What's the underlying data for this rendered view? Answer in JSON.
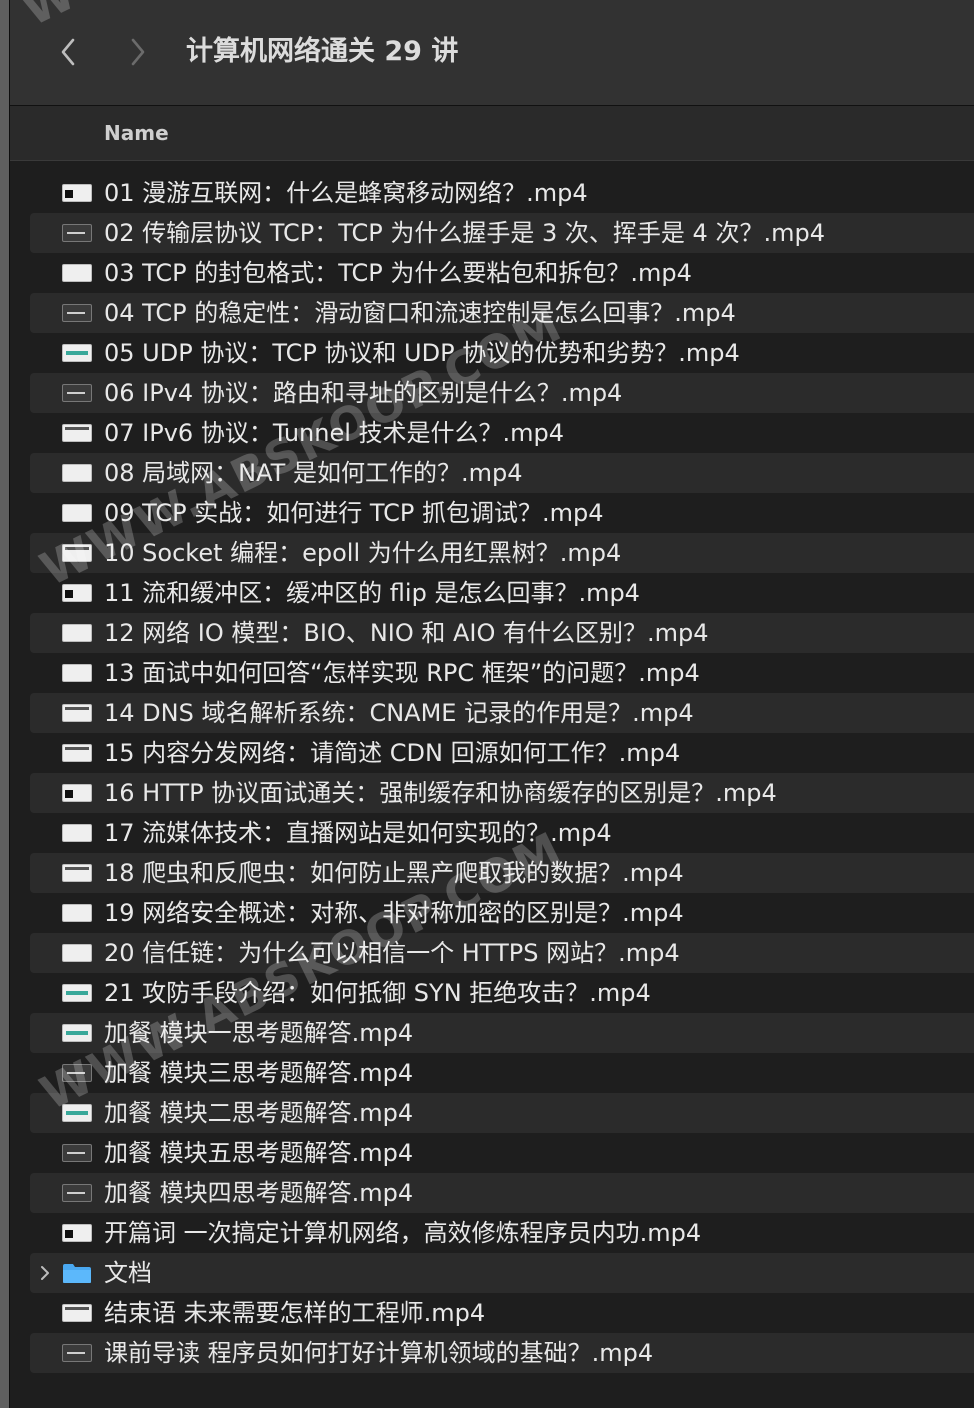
{
  "window": {
    "title": "计算机网络通关 29 讲",
    "back_icon": "chevron-left-icon",
    "forward_icon": "chevron-right-icon"
  },
  "columns": {
    "name": "Name"
  },
  "watermark": "WWW.ABSKOOP.COM",
  "files": [
    {
      "name": "01  漫游互联网：什么是蜂窝移动网络？.mp4",
      "kind": "video",
      "thumb": "mark"
    },
    {
      "name": "02  传输层协议 TCP：TCP 为什么握手是 3 次、挥手是 4 次？.mp4",
      "kind": "video",
      "thumb": "dark"
    },
    {
      "name": "03  TCP 的封包格式：TCP 为什么要粘包和拆包？.mp4",
      "kind": "video",
      "thumb": "plain"
    },
    {
      "name": "04  TCP 的稳定性：滑动窗口和流速控制是怎么回事？.mp4",
      "kind": "video",
      "thumb": "dark"
    },
    {
      "name": "05  UDP 协议：TCP 协议和 UDP 协议的优势和劣势？.mp4",
      "kind": "video",
      "thumb": "teal"
    },
    {
      "name": "06  IPv4 协议：路由和寻址的区别是什么？.mp4",
      "kind": "video",
      "thumb": "dark"
    },
    {
      "name": "07  IPv6 协议：Tunnel 技术是什么？.mp4",
      "kind": "video",
      "thumb": "bar"
    },
    {
      "name": "08  局域网：NAT 是如何工作的？.mp4",
      "kind": "video",
      "thumb": "plain"
    },
    {
      "name": "09  TCP 实战：如何进行 TCP 抓包调试？.mp4",
      "kind": "video",
      "thumb": "plain"
    },
    {
      "name": "10  Socket 编程：epoll 为什么用红黑树？.mp4",
      "kind": "video",
      "thumb": "bar"
    },
    {
      "name": "11  流和缓冲区：缓冲区的 flip 是怎么回事？.mp4",
      "kind": "video",
      "thumb": "mark"
    },
    {
      "name": "12  网络 IO 模型：BIO、NIO 和 AIO 有什么区别？.mp4",
      "kind": "video",
      "thumb": "plain"
    },
    {
      "name": "13  面试中如何回答“怎样实现 RPC 框架”的问题？.mp4",
      "kind": "video",
      "thumb": "plain"
    },
    {
      "name": "14  DNS 域名解析系统：CNAME 记录的作用是？.mp4",
      "kind": "video",
      "thumb": "bar"
    },
    {
      "name": "15  内容分发网络：请简述 CDN 回源如何工作？.mp4",
      "kind": "video",
      "thumb": "bar"
    },
    {
      "name": "16  HTTP 协议面试通关：强制缓存和协商缓存的区别是？.mp4",
      "kind": "video",
      "thumb": "mark"
    },
    {
      "name": "17  流媒体技术：直播网站是如何实现的？.mp4",
      "kind": "video",
      "thumb": "plain"
    },
    {
      "name": "18  爬虫和反爬虫：如何防止黑产爬取我的数据？.mp4",
      "kind": "video",
      "thumb": "bar"
    },
    {
      "name": "19  网络安全概述：对称、非对称加密的区别是？.mp4",
      "kind": "video",
      "thumb": "plain"
    },
    {
      "name": "20  信任链：为什么可以相信一个 HTTPS 网站？.mp4",
      "kind": "video",
      "thumb": "plain"
    },
    {
      "name": "21  攻防手段介绍：如何抵御 SYN 拒绝攻击？.mp4",
      "kind": "video",
      "thumb": "teal"
    },
    {
      "name": "加餐  模块一思考题解答.mp4",
      "kind": "video",
      "thumb": "teal"
    },
    {
      "name": "加餐  模块三思考题解答.mp4",
      "kind": "video",
      "thumb": "dark"
    },
    {
      "name": "加餐  模块二思考题解答.mp4",
      "kind": "video",
      "thumb": "teal"
    },
    {
      "name": "加餐  模块五思考题解答.mp4",
      "kind": "video",
      "thumb": "dark"
    },
    {
      "name": "加餐  模块四思考题解答.mp4",
      "kind": "video",
      "thumb": "dark"
    },
    {
      "name": "开篇词  一次搞定计算机网络，高效修炼程序员内功.mp4",
      "kind": "video",
      "thumb": "mark"
    },
    {
      "name": "文档",
      "kind": "folder",
      "thumb": "folder-icon"
    },
    {
      "name": "结束语  未来需要怎样的工程师.mp4",
      "kind": "video",
      "thumb": "bar"
    },
    {
      "name": "课前导读  程序员如何打好计算机领域的基础？.mp4",
      "kind": "video",
      "thumb": "dark"
    }
  ]
}
